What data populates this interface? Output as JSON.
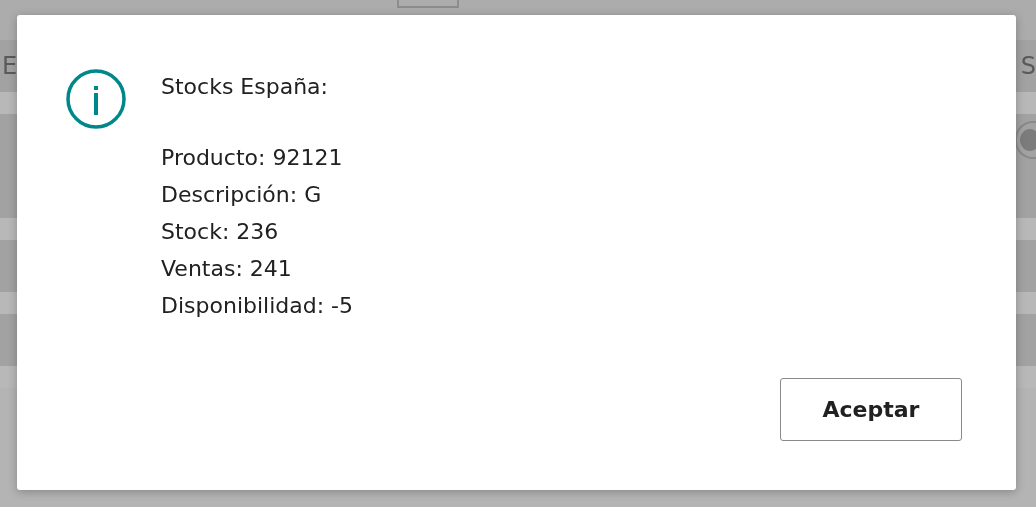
{
  "background": {
    "left_text": "E",
    "right_text": "S"
  },
  "dialog": {
    "title": "Stocks España:",
    "lines": [
      "Producto: 92121",
      "Descripción: G",
      "Stock: 236",
      "Ventas: 241",
      "Disponibilidad: -5"
    ],
    "button": "Aceptar"
  }
}
